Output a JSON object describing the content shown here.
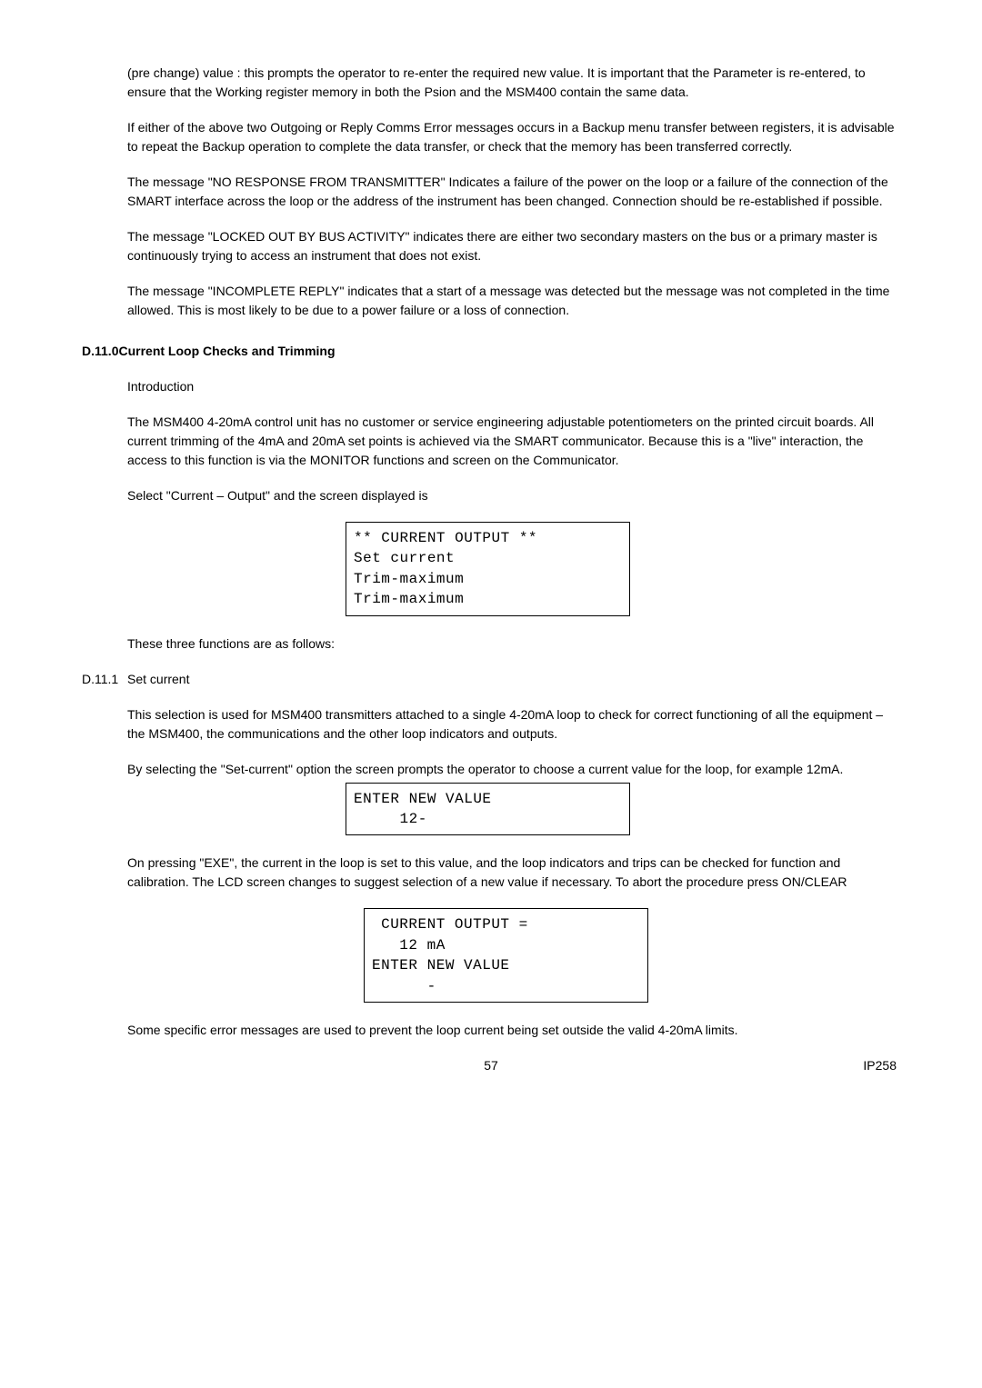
{
  "p1": "(pre change) value : this prompts the operator to re-enter the required new value.  It is important that the Parameter is re-entered, to ensure that the Working register memory in both the Psion and the MSM400 contain the same data.",
  "p2": "If either of the above two Outgoing or Reply Comms Error messages occurs in a Backup menu transfer between registers, it is advisable to repeat the Backup operation to complete the data transfer, or check that the memory has been transferred correctly.",
  "p3": "The message \"NO RESPONSE FROM TRANSMITTER\" Indicates a failure of the power on the loop or a failure of the connection of the SMART interface across the loop or the address of the instrument has been changed.  Connection should be re-established if possible.",
  "p4": "The message \"LOCKED OUT BY BUS ACTIVITY\" indicates there are either two secondary masters on the bus or a primary master is continuously trying to access an instrument that does not exist.",
  "p5": "The message \"INCOMPLETE REPLY\" indicates that a start of a message was detected but the message was not completed in the time allowed.  This is most likely to be due to a power failure or a loss of connection.",
  "section_d11_0": {
    "num": "D.11.0",
    "title": "Current Loop Checks and Trimming"
  },
  "p6": "Introduction",
  "p7": "The MSM400 4-20mA control unit has no customer or service engineering adjustable potentiometers on the printed circuit boards.  All current trimming of the 4mA and 20mA set points is achieved via the SMART communicator.  Because this is a \"live\" interaction, the access to this function is via the MONITOR functions and screen on the Communicator.",
  "p8": "Select \"Current – Output\" and the screen displayed is",
  "box1": "** CURRENT OUTPUT **\nSet current\nTrim-maximum\nTrim-maximum",
  "p9": "These three functions are as follows:",
  "section_d11_1": {
    "num": "D.11.1",
    "title": "Set current"
  },
  "p10": "This selection is used for MSM400 transmitters attached to a single 4-20mA loop to check for correct functioning of all the equipment – the MSM400, the communications and the other loop indicators and outputs.",
  "p11": "By selecting the \"Set-current\" option the screen prompts the operator to choose a current value for the loop, for example 12mA.",
  "box2": "ENTER NEW VALUE\n     12-",
  "p12": "On pressing \"EXE\", the current in the loop is set to this value, and the loop indicators and trips can be checked for function and calibration.  The LCD screen changes to suggest selection of a new value if necessary.  To abort the procedure press ON/CLEAR",
  "box3": " CURRENT OUTPUT =\n   12 mA\nENTER NEW VALUE\n      -",
  "p13": "Some specific error messages are used to prevent the loop current being set outside the valid 4-20mA limits.",
  "footer": {
    "page": "57",
    "code": "IP258"
  }
}
